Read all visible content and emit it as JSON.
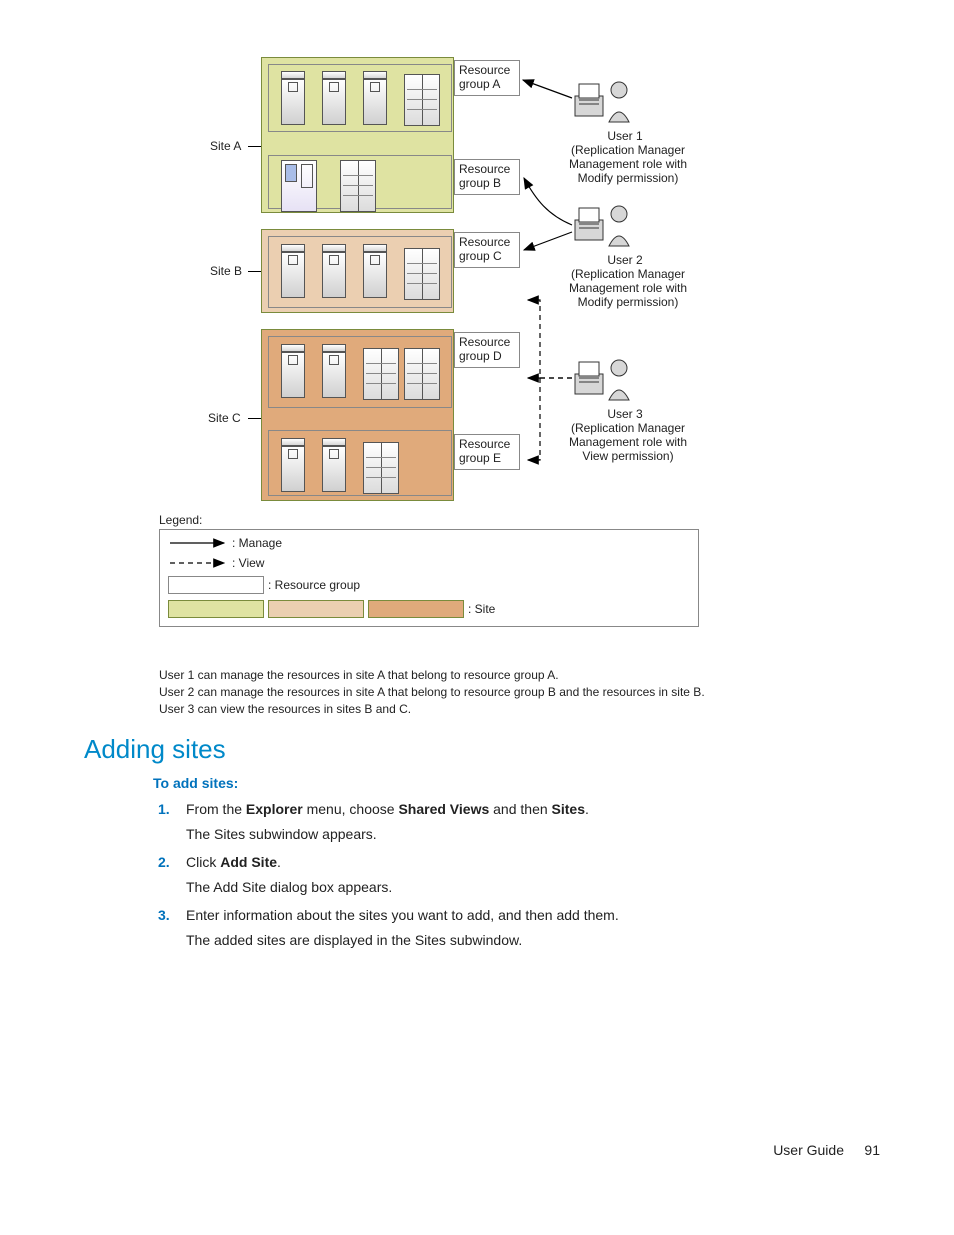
{
  "diagram": {
    "siteA_label": "Site A",
    "siteB_label": "Site B",
    "siteC_label": "Site C",
    "rgA": "Resource\ngroup A",
    "rgB": "Resource\ngroup B",
    "rgC": "Resource\ngroup C",
    "rgD": "Resource\ngroup D",
    "rgE": "Resource\ngroup E",
    "user1_name": "User 1",
    "user1_desc": "(Replication Manager\nManagement role with\nModify permission)",
    "user2_name": "User 2",
    "user2_desc": "(Replication Manager\nManagement role with\nModify permission)",
    "user3_name": "User 3",
    "user3_desc": "(Replication Manager\nManagement role with\nView permission)",
    "legend_title": "Legend:",
    "legend_manage": ": Manage",
    "legend_view": ": View",
    "legend_resgroup": ": Resource group",
    "legend_site": ": Site",
    "notes": {
      "n1": "User 1 can manage the resources in site A that belong to resource group A.",
      "n2": "User 2 can manage the resources in site A that belong to resource group B and the resources in site B.",
      "n3": "User 3 can view the resources in sites B and C."
    }
  },
  "article": {
    "heading": "Adding sites",
    "subheading": "To add sites:",
    "step1_pre": "From the ",
    "step1_b1": "Explorer",
    "step1_mid": " menu, choose ",
    "step1_b2": "Shared Views",
    "step1_mid2": " and then ",
    "step1_b3": "Sites",
    "step1_end": ".",
    "step1_after": "The Sites subwindow appears.",
    "step2_pre": "Click ",
    "step2_b1": "Add Site",
    "step2_end": ".",
    "step2_after": "The Add Site dialog box appears.",
    "step3": "Enter information about the sites you want to add, and then add them.",
    "step3_after": "The added sites are displayed in the Sites subwindow.",
    "num1": "1.",
    "num2": "2.",
    "num3": "3."
  },
  "footer": {
    "guide": "User Guide",
    "page": "91"
  }
}
